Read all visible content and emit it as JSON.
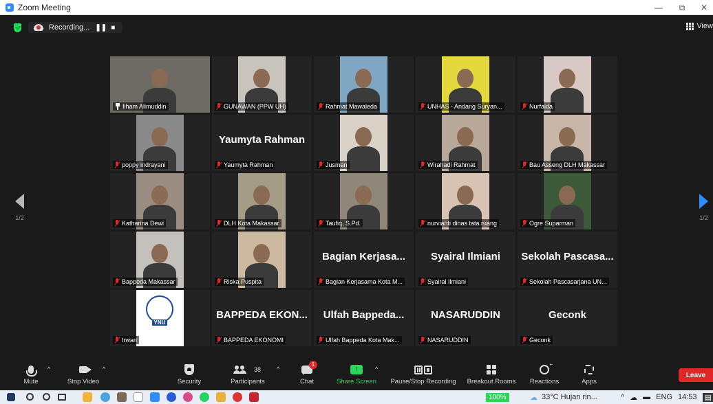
{
  "window": {
    "title": "Zoom Meeting",
    "controls": [
      "—",
      "⧉",
      "✕"
    ]
  },
  "top_bar": {
    "recording_label": "Recording...",
    "pause_glyph": "❚❚",
    "stop_glyph": "■",
    "view_label": "View"
  },
  "pager": {
    "left_page": "1/2",
    "right_page": "1/2"
  },
  "tiles": [
    {
      "name": "Ilham Alimuddin",
      "big": "",
      "active": true,
      "pinned": true,
      "muted": false,
      "video": true,
      "bg": "#6d6b63"
    },
    {
      "name": "GUNAWAN (PPW UH)",
      "big": "",
      "muted": true,
      "video": true,
      "bg": "#c9c5bd"
    },
    {
      "name": "Rahmat Mawaleda",
      "big": "",
      "muted": true,
      "video": true,
      "bg": "#7fa7c4"
    },
    {
      "name": "UNHAS - Andang Suryan...",
      "big": "",
      "muted": true,
      "video": true,
      "bg": "#e3d93c"
    },
    {
      "name": "Nurfaida",
      "big": "",
      "muted": true,
      "video": true,
      "bg": "#d8c9c4"
    },
    {
      "name": "poppy indrayani",
      "big": "",
      "muted": true,
      "video": true,
      "bg": "#8a8a8a"
    },
    {
      "name": "Yaumyta Rahman",
      "big": "Yaumyta Rahman",
      "muted": true,
      "video": false
    },
    {
      "name": "Jusman",
      "big": "",
      "muted": true,
      "video": true,
      "bg": "#d8d2c6"
    },
    {
      "name": "Wirahadi Rahmat",
      "big": "",
      "muted": true,
      "video": true,
      "bg": "#b9a99a"
    },
    {
      "name": "Bau Asseng DLH Makassar",
      "big": "",
      "muted": true,
      "video": true,
      "bg": "#c8b6a8"
    },
    {
      "name": "Katharina Dewi",
      "big": "",
      "muted": true,
      "video": true,
      "bg": "#9a8c80"
    },
    {
      "name": "DLH Kota Makassar",
      "big": "",
      "muted": true,
      "video": true,
      "bg": "#a59c88"
    },
    {
      "name": "Taufiq, S.Pd.",
      "big": "",
      "muted": true,
      "video": true,
      "bg": "#8f8778"
    },
    {
      "name": "nurvianti dinas tata ruang",
      "big": "",
      "muted": true,
      "video": true,
      "bg": "#d9c3b4"
    },
    {
      "name": "Ogre Suparman",
      "big": "",
      "muted": true,
      "video": true,
      "bg": "#3d5a3a"
    },
    {
      "name": "Bappeda Makassar",
      "big": "",
      "muted": true,
      "video": true,
      "bg": "#c4c0bb"
    },
    {
      "name": "Riska Puspita",
      "big": "",
      "muted": true,
      "video": true,
      "bg": "#cdb9a0"
    },
    {
      "name": "Bagian Kerjasama Kota M...",
      "big": "Bagian Kerjasa...",
      "muted": true,
      "video": false
    },
    {
      "name": "Syairal Ilmiani",
      "big": "Syairal Ilmiani",
      "muted": true,
      "video": false
    },
    {
      "name": "Sekolah Pascasarjana UN...",
      "big": "Sekolah Pascasa...",
      "muted": true,
      "video": false
    },
    {
      "name": "Irwan",
      "big": "",
      "muted": true,
      "video": true,
      "bg": "#ffffff",
      "logo": "YNU"
    },
    {
      "name": "BAPPEDA EKONOMI",
      "big": "BAPPEDA EKON...",
      "muted": true,
      "video": false
    },
    {
      "name": "Ulfah Bappeda Kota Mak...",
      "big": "Ulfah Bappeda...",
      "muted": true,
      "video": false
    },
    {
      "name": "NASARUDDIN",
      "big": "NASARUDDIN",
      "muted": true,
      "video": false
    },
    {
      "name": "Geconk",
      "big": "Geconk",
      "muted": true,
      "video": false
    }
  ],
  "toolbar": {
    "mute": "Mute",
    "stop_video": "Stop Video",
    "security": "Security",
    "participants": "Participants",
    "participants_count": "38",
    "chat": "Chat",
    "chat_badge": "1",
    "share_screen": "Share Screen",
    "recording": "Pause/Stop Recording",
    "breakout": "Breakout Rooms",
    "reactions": "Reactions",
    "apps": "Apps",
    "leave": "Leave"
  },
  "taskbar": {
    "zoom_level": "100%",
    "weather": "33°C Hujan rin...",
    "language": "ENG",
    "time": "14:53"
  }
}
